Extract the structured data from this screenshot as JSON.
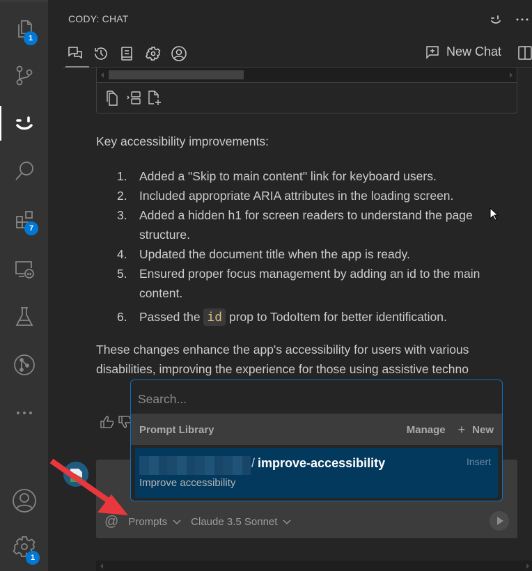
{
  "activity_bar": {
    "items": [
      {
        "name": "explorer",
        "badge": "1"
      },
      {
        "name": "source-control",
        "badge": null
      },
      {
        "name": "cody",
        "badge": null,
        "active": true
      },
      {
        "name": "search",
        "badge": null
      },
      {
        "name": "extensions",
        "badge": "7"
      },
      {
        "name": "remote-explorer",
        "badge": null
      },
      {
        "name": "testing",
        "badge": null
      },
      {
        "name": "git-graph",
        "badge": null
      },
      {
        "name": "more",
        "badge": null
      }
    ],
    "accounts_badge": null,
    "settings_badge": "1"
  },
  "panel": {
    "title": "CODY: CHAT",
    "tabs": [
      "chat",
      "history",
      "prompts",
      "settings",
      "account"
    ],
    "new_chat_label": "New Chat"
  },
  "message": {
    "lead": "Key accessibility improvements:",
    "items": [
      {
        "num": "1.",
        "text": "Added a \"Skip to main content\" link for keyboard users."
      },
      {
        "num": "2.",
        "text": "Included appropriate ARIA attributes in the loading screen."
      },
      {
        "num": "3.",
        "text": "Added a hidden h1 for screen readers to understand the page structure."
      },
      {
        "num": "4.",
        "text": "Updated the document title when the app is ready."
      },
      {
        "num": "5.",
        "text": "Ensured proper focus management by adding an id to the main content."
      },
      {
        "num": "6.",
        "before": "Passed the ",
        "code": "id",
        "after": " prop to TodoItem for better identification."
      }
    ],
    "summary": "These changes enhance the app's accessibility for users with various disabilities, improving the experience for those using assistive techno"
  },
  "popup": {
    "search_placeholder": "Search...",
    "section_title": "Prompt Library",
    "manage_label": "Manage",
    "new_label": "New",
    "item": {
      "name": "improve-accessibility",
      "description": "Improve accessibility",
      "action": "Insert"
    }
  },
  "input": {
    "prompts_label": "Prompts",
    "model_label": "Claude 3.5 Sonnet"
  },
  "colors": {
    "accent": "#0078d4",
    "selection": "#04395e",
    "annotation_arrow": "#e8383d"
  }
}
